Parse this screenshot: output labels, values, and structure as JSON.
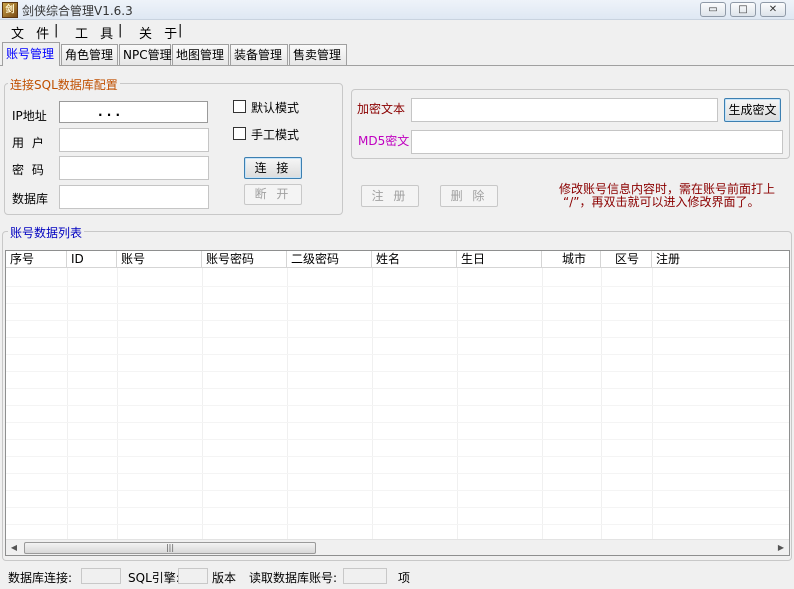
{
  "window": {
    "title": "剑侠综合管理V1.6.3",
    "icon_name": "app-logo-icon",
    "minimize_symbol": "▭",
    "maximize_symbol": "□",
    "close_symbol": "✕"
  },
  "menu": {
    "items": [
      {
        "label": "文 件"
      },
      {
        "label": "|"
      },
      {
        "label": "工 具"
      },
      {
        "label": "|"
      },
      {
        "label": "关 于"
      },
      {
        "label": "|"
      }
    ]
  },
  "tabs": [
    {
      "label": "账号管理",
      "active": true
    },
    {
      "label": "角色管理"
    },
    {
      "label": "NPC管理"
    },
    {
      "label": "地图管理"
    },
    {
      "label": "装备管理"
    },
    {
      "label": "售卖管理"
    }
  ],
  "connection": {
    "group_title": "连接SQL数据库配置",
    "ip_label": "IP地址",
    "ip_value": ".   .   .",
    "user_label": "用  户",
    "password_label": "密  码",
    "database_label": "数据库",
    "default_mode_label": "默认模式",
    "manual_mode_label": "手工模式",
    "connect_button": "连 接",
    "disconnect_button": "断 开"
  },
  "encrypt": {
    "plain_label": "加密文本",
    "md5_label": "MD5密文",
    "generate_button": "生成密文"
  },
  "actions": {
    "register_button": "注 册",
    "delete_button": "删 除",
    "hint_line1": "修改账号信息内容时，需在账号前面打上",
    "hint_line2": "“/”，再双击就可以进入修改界面了。",
    "hint_color": "#8b0000"
  },
  "table": {
    "group_title": "账号数据列表",
    "columns": [
      "序号",
      "ID",
      "账号",
      "账号密码",
      "二级密码",
      "姓名",
      "生日",
      "城市",
      "区号",
      "注册"
    ],
    "rows": [],
    "scroll_thumb_glyph": "|||",
    "scroll_left": "◀",
    "scroll_right": "▶"
  },
  "status": {
    "db_conn_label": "数据库连接:",
    "sql_engine_label": "SQL引擎:",
    "version_label": "版本",
    "read_accounts_label": "读取数据库账号:",
    "items_unit": "项"
  },
  "colors": {
    "group_title": "#c05000",
    "active_tab": "#0000ff",
    "md5_label": "#c000c0",
    "plain_label": "#8b0000",
    "table_title": "#0000c0"
  }
}
